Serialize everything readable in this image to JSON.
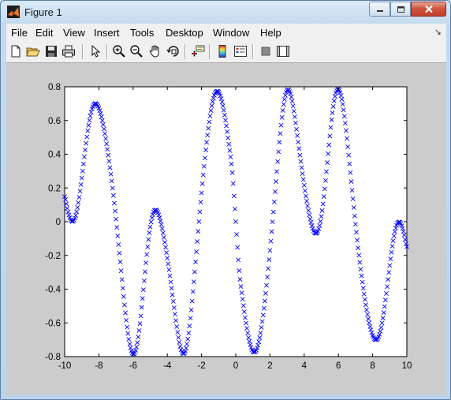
{
  "window": {
    "title": "Figure 1"
  },
  "menu": {
    "items": [
      "File",
      "Edit",
      "View",
      "Insert",
      "Tools",
      "Desktop",
      "Window",
      "Help"
    ]
  },
  "toolbar": {
    "buttons": [
      "new-figure",
      "open-file",
      "save",
      "print",
      "edit-plot",
      "zoom-in",
      "zoom-out",
      "pan",
      "rotate-3d",
      "data-cursor",
      "insert-colorbar",
      "insert-legend",
      "hide-plot-tools",
      "show-plot-tools"
    ]
  },
  "colors": {
    "marker": "#0000ff",
    "figure_background": "#cccccc",
    "axes_background": "#ffffff"
  },
  "chart_data": {
    "type": "scatter",
    "marker": "x",
    "xlim": [
      -10,
      10
    ],
    "ylim": [
      -0.8,
      0.8
    ],
    "xticks": [
      -10,
      -8,
      -6,
      -4,
      -2,
      0,
      2,
      4,
      6,
      8,
      10
    ],
    "yticks": [
      -0.8,
      -0.6,
      -0.4,
      -0.2,
      0,
      0.2,
      0.4,
      0.6,
      0.8
    ],
    "xticklabels": [
      "-10",
      "-8",
      "-6",
      "-4",
      "-2",
      "0",
      "2",
      "4",
      "6",
      "8",
      "10"
    ],
    "yticklabels": [
      "-0.8",
      "-0.6",
      "-0.4",
      "-0.2",
      "0",
      "0.2",
      "0.4",
      "0.6",
      "0.8"
    ],
    "grid": false,
    "title": "",
    "xlabel": "",
    "ylabel": "",
    "series": [
      {
        "x": [
          -10,
          -9.8,
          -9.6,
          -9.4,
          -9.2,
          -9,
          -8.8,
          -8.6,
          -8.4,
          -8.2,
          -8,
          -7.8,
          -7.6,
          -7.4,
          -7.2,
          -7,
          -6.8,
          -6.6,
          -6.4,
          -6.2,
          -6,
          -5.8,
          -5.6,
          -5.4,
          -5.2,
          -5,
          -4.8,
          -4.6,
          -4.4,
          -4.2,
          -4,
          -3.8,
          -3.6,
          -3.4,
          -3.2,
          -3,
          -2.8,
          -2.6,
          -2.4,
          -2.2,
          -2,
          -1.8,
          -1.6,
          -1.4,
          -1.2,
          -1,
          -0.8,
          -0.6,
          -0.4,
          -0.2,
          0,
          0.2,
          0.4,
          0.6,
          0.8,
          1,
          1.2,
          1.4,
          1.6,
          1.8,
          2,
          2.2,
          2.4,
          2.6,
          2.8,
          3,
          3.2,
          3.4,
          3.6,
          3.8,
          4,
          4.2,
          4.4,
          4.6,
          4.8,
          5,
          5.2,
          5.4,
          5.6,
          5.8,
          6,
          6.2,
          6.4,
          6.6,
          6.8,
          7,
          7.2,
          7.4,
          7.6,
          7.8,
          8,
          8.2,
          8.4,
          8.6,
          8.8,
          9,
          9.2,
          9.4,
          9.6,
          9.8,
          10
        ],
        "y": [
          0.1485,
          0.0574,
          0.0039,
          0.0213,
          0.1129,
          0.2596,
          0.4255,
          0.5718,
          0.6681,
          0.7007,
          0.6734,
          0.5997,
          0.4927,
          0.3585,
          0.1989,
          0.0152,
          -0.1866,
          -0.3941,
          -0.5843,
          -0.7252,
          -0.7847,
          -0.7429,
          -0.6042,
          -0.4032,
          -0.1947,
          -0.0311,
          0.0569,
          0.0633,
          0.0045,
          -0.0936,
          -0.2162,
          -0.3573,
          -0.5101,
          -0.6555,
          -0.7587,
          -0.7789,
          -0.6956,
          -0.5232,
          -0.2977,
          -0.0578,
          0.1708,
          0.3774,
          0.5541,
          0.6876,
          0.7621,
          0.7684,
          0.7102,
          0.6011,
          0.4593,
          0.2902,
          0.0,
          -0.2902,
          -0.4593,
          -0.6011,
          -0.7102,
          -0.7684,
          -0.7621,
          -0.6876,
          -0.5541,
          -0.3774,
          -0.1708,
          0.0578,
          0.2977,
          0.5232,
          0.6956,
          0.7789,
          0.7587,
          0.6555,
          0.5101,
          0.3573,
          0.2162,
          0.0936,
          -0.0045,
          -0.0633,
          -0.0569,
          0.0311,
          0.1947,
          0.4032,
          0.6042,
          0.7429,
          0.7847,
          0.7252,
          0.5843,
          0.3941,
          0.1866,
          -0.0152,
          -0.1989,
          -0.3585,
          -0.4927,
          -0.5997,
          -0.6734,
          -0.7007,
          -0.6681,
          -0.5718,
          -0.4255,
          -0.2596,
          -0.1129,
          -0.0213,
          -0.0039,
          -0.0574,
          -0.1485
        ]
      }
    ]
  }
}
